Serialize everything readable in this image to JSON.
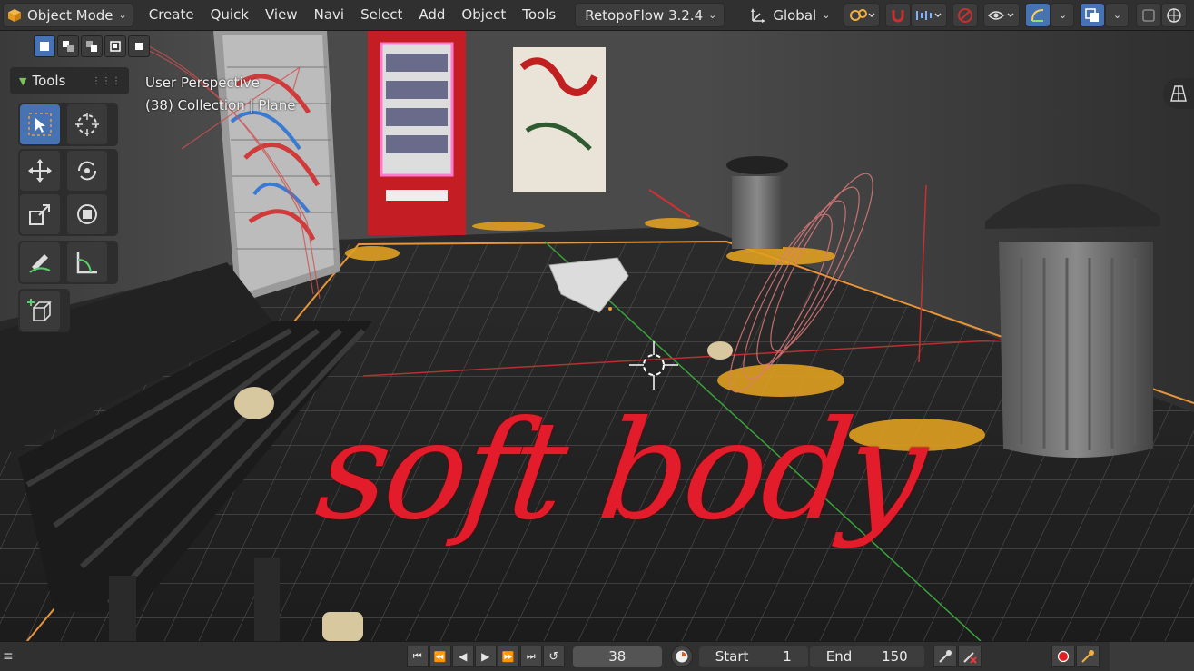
{
  "header": {
    "mode_label": "Object Mode",
    "menus": [
      "Create",
      "Quick",
      "View",
      "Navi",
      "Select",
      "Add",
      "Object",
      "Tools"
    ],
    "addon_label": "RetopoFlow 3.2.4",
    "orientation_label": "Global"
  },
  "viewport": {
    "view_name": "User Perspective",
    "collection_info": "(38) Collection | Plane",
    "tools_panel_title": "Tools",
    "overlay_caption": "soft body"
  },
  "timeline": {
    "current_frame": "38",
    "start_label": "Start",
    "start_value": "1",
    "end_label": "End",
    "end_value": "150"
  },
  "colors": {
    "accent": "#4772b3",
    "caption_red": "#e21c2b",
    "header_bg": "#303030",
    "floor_outline": "#e8953a"
  },
  "icons": [
    "cube-icon",
    "chevron-down-icon",
    "axes-icon",
    "snap-icon",
    "magnet-icon",
    "proportional-icon",
    "visibility-icon",
    "gizmo-icon",
    "overlay-icon",
    "xray-icon",
    "shading-icon",
    "grid-view-icon",
    "select-box-icon",
    "cursor-icon",
    "move-icon",
    "rotate-icon",
    "scale-icon",
    "transform-icon",
    "annotate-icon",
    "measure-icon",
    "add-cube-icon",
    "jump-start-icon",
    "prev-key-icon",
    "play-reverse-icon",
    "play-icon",
    "next-key-icon",
    "jump-end-icon",
    "loop-icon",
    "record-icon",
    "keyframe-icon"
  ]
}
